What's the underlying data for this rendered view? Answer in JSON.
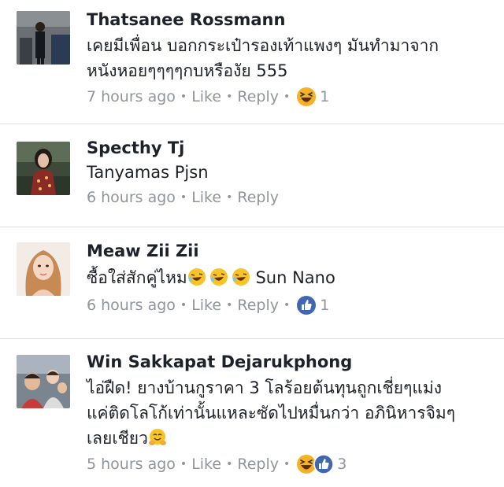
{
  "comments": [
    {
      "author": "Thatsanee Rossmann",
      "lines": [
        "เคยมีเพื่อน บอกกระเป๋ารองเท้าแพงๆ มันทำมาจาก",
        "หนังหอยๆๆๆๆกบหรืองัย 555"
      ],
      "time": "7 hours ago",
      "like": "Like",
      "reply": "Reply",
      "reactions": [
        "haha"
      ],
      "reaction_count": "1"
    },
    {
      "author": "Specthy Tj",
      "mention": "Tanyamas Pjsn",
      "time": "6 hours ago",
      "like": "Like",
      "reply": "Reply"
    },
    {
      "author": "Meaw Zii Zii",
      "text": "ซื้อใส่สักคู่ไหม",
      "mention": "Sun Nano",
      "time": "6 hours ago",
      "like": "Like",
      "reply": "Reply",
      "reactions": [
        "like"
      ],
      "reaction_count": "1"
    },
    {
      "author": "Win Sakkapat Dejarukphong",
      "lines": [
        "ไอ่ฝืด! ยางบ้านกูราคา 3 โลร้อยต้นทุนถูกเชี่ยๆแม่ง",
        "แค่ติดโลโก้เท่านั้นแหละซัดไปหมื่นกว่า อภินิหารจิมๆ",
        "เลยเชียว"
      ],
      "time": "5 hours ago",
      "like": "Like",
      "reply": "Reply",
      "reactions": [
        "haha",
        "like"
      ],
      "reaction_count": "3"
    }
  ],
  "colors": {
    "meta_gray": "#90949c",
    "text": "#1d2129",
    "like_blue": "#4267b2",
    "haha_yellow": "#f7b125",
    "divider": "#dddfe2"
  }
}
